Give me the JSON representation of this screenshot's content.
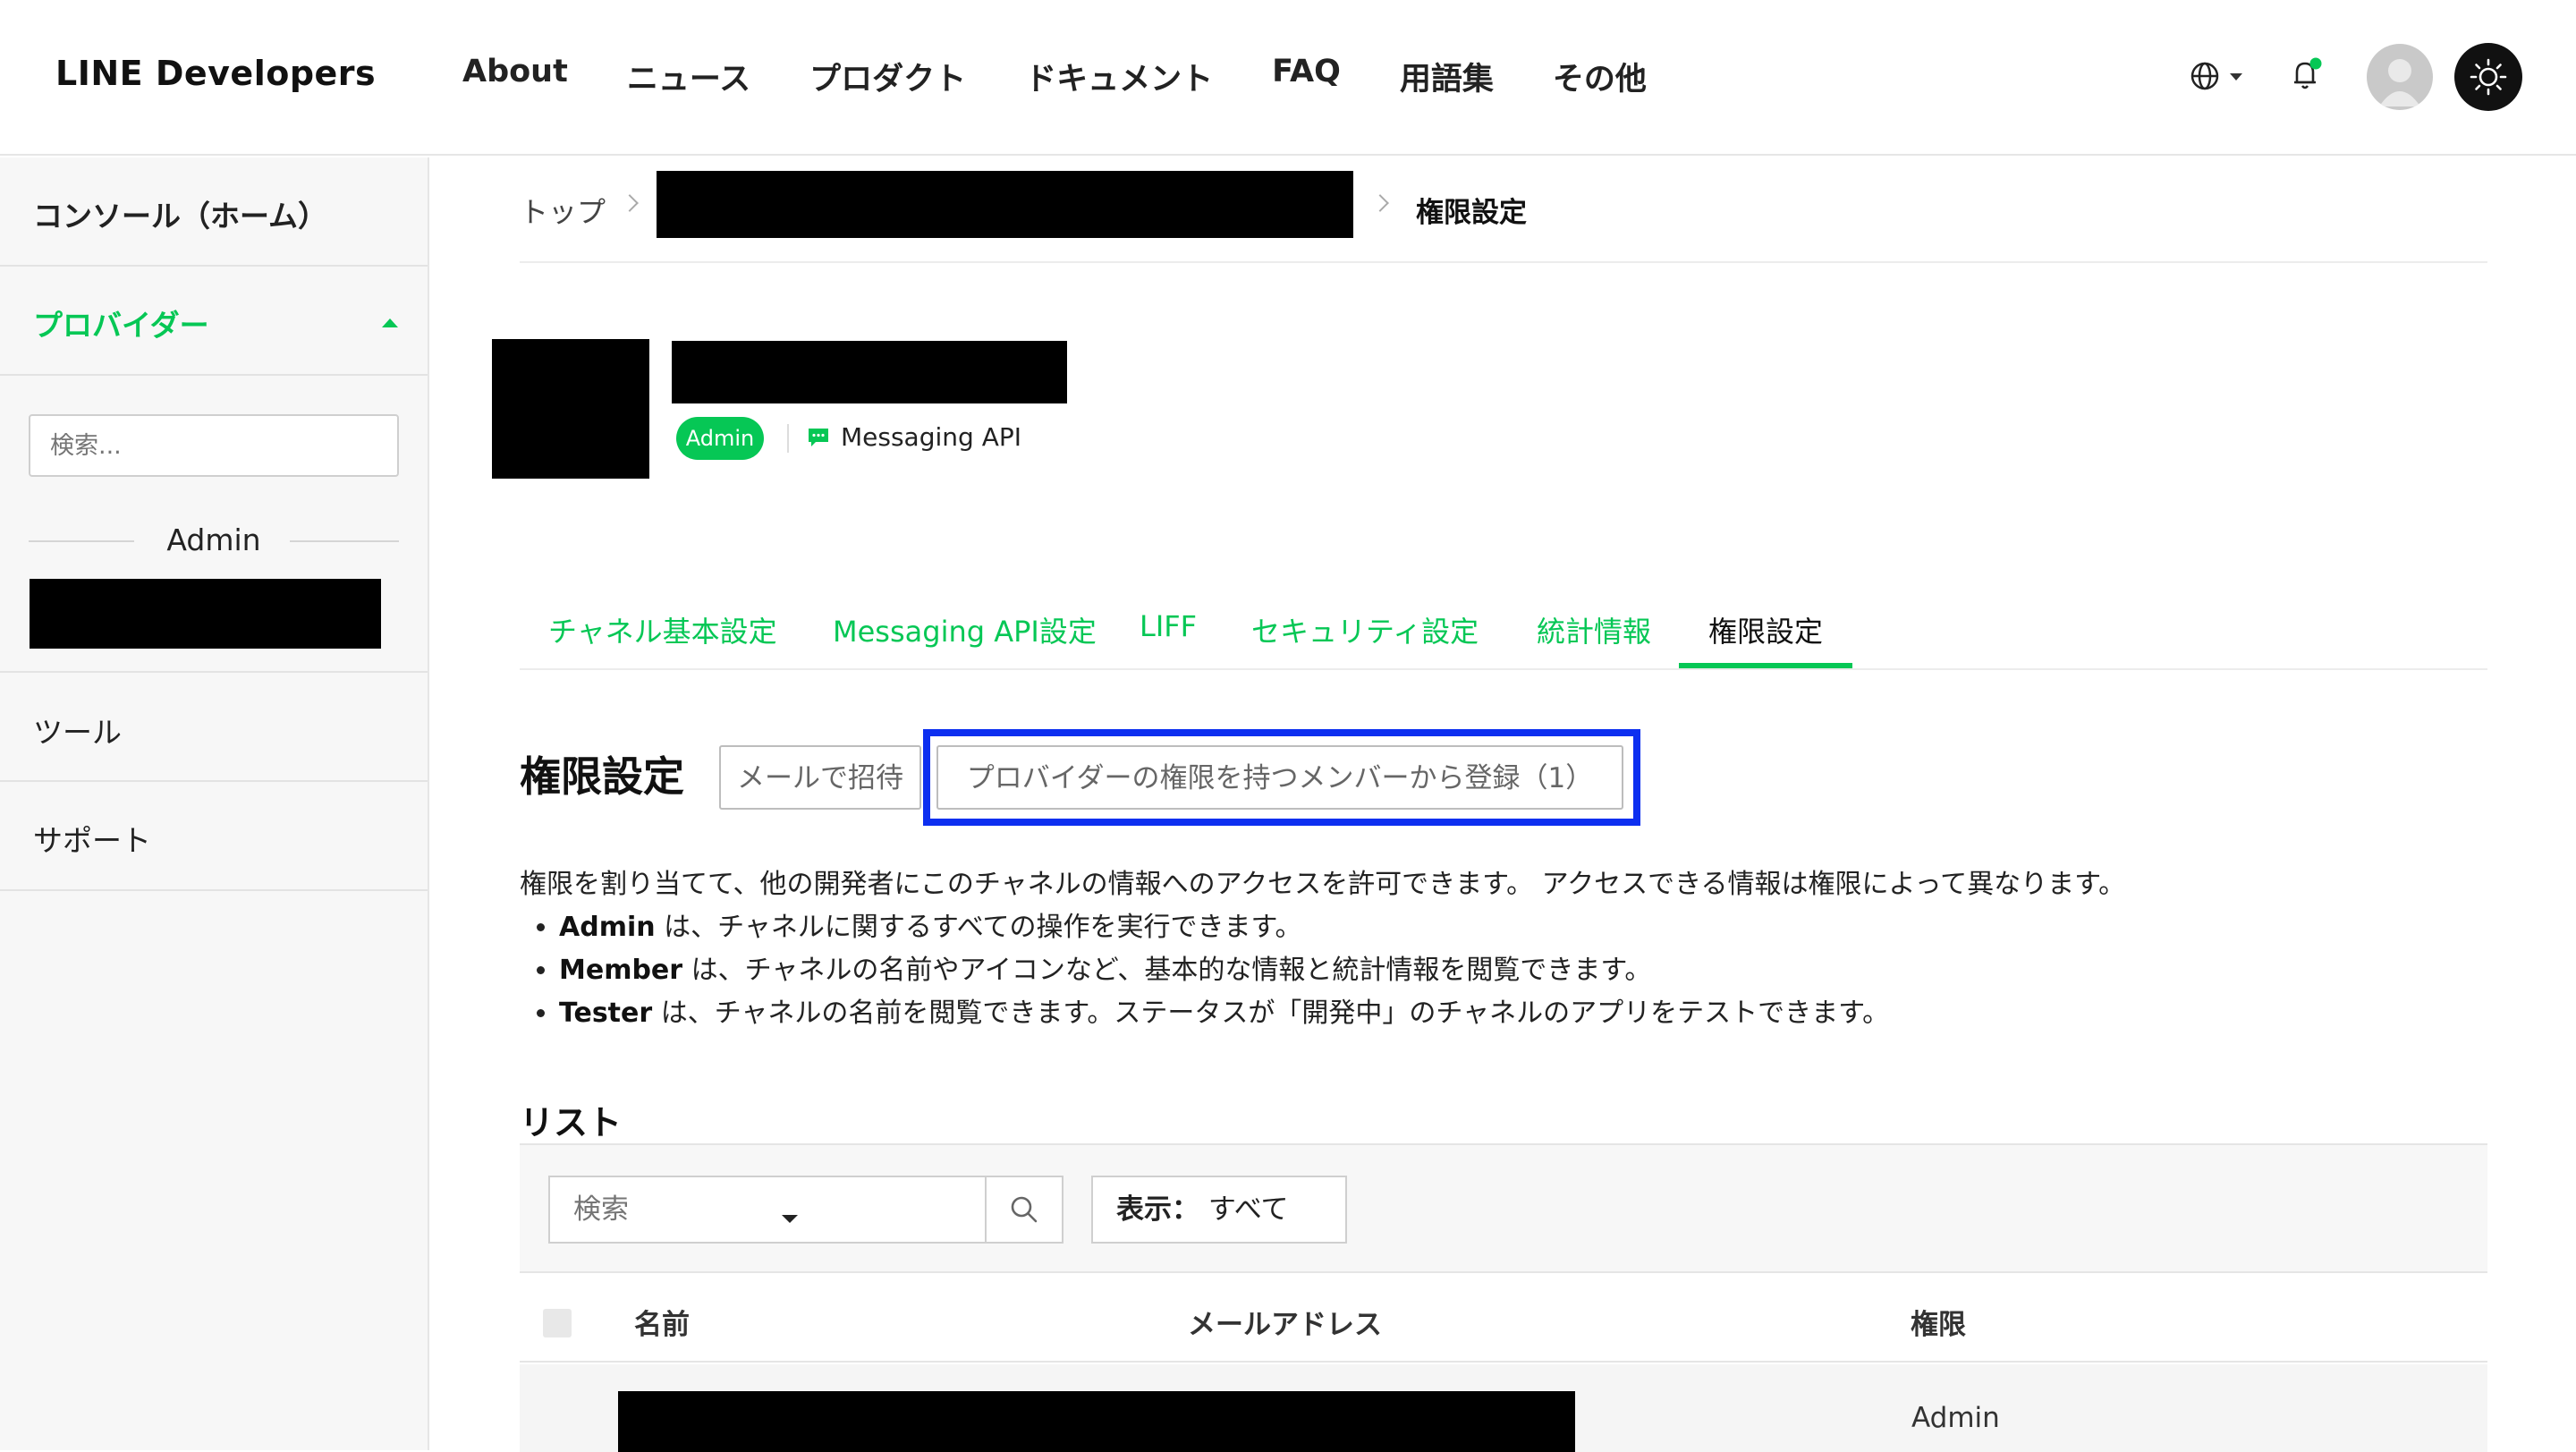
{
  "header": {
    "logo": "LINE Developers",
    "nav": [
      "About",
      "ニュース",
      "プロダクト",
      "ドキュメント",
      "FAQ",
      "用語集",
      "その他"
    ],
    "icons": [
      "globe-icon",
      "bell-icon",
      "avatar",
      "sun-icon"
    ],
    "notification_dot_color": "#06c755"
  },
  "sidebar": {
    "console": "コンソール（ホーム）",
    "provider": "プロバイダー",
    "search_placeholder": "検索...",
    "role_heading": "Admin",
    "tools": "ツール",
    "support": "サポート"
  },
  "breadcrumb": {
    "top": "トップ",
    "current": "権限設定"
  },
  "channel": {
    "role_badge": "Admin",
    "type": "Messaging API"
  },
  "tabs": [
    "チャネル基本設定",
    "Messaging API設定",
    "LIFF",
    "セキュリティ設定",
    "統計情報",
    "権限設定"
  ],
  "permissions": {
    "title": "権限設定",
    "invite_button": "メールで招待",
    "register_button": "プロバイダーの権限を持つメンバーから登録（1）",
    "description": "権限を割り当てて、他の開発者にこのチャネルの情報へのアクセスを許可できます。 アクセスできる情報は権限によって異なります。",
    "roles": [
      {
        "name": "Admin",
        "text": " は、チャネルに関するすべての操作を実行できます。"
      },
      {
        "name": "Member",
        "text": " は、チャネルの名前やアイコンなど、基本的な情報と統計情報を閲覧できます。"
      },
      {
        "name": "Tester",
        "text": " は、チャネルの名前を閲覧できます。ステータスが「開発中」のチャネルのアプリをテストできます。"
      }
    ]
  },
  "list": {
    "title": "リスト",
    "search_placeholder": "検索",
    "filter_label": "表示：",
    "filter_value": "すべて",
    "columns": [
      "名前",
      "メールアドレス",
      "権限"
    ],
    "rows": [
      {
        "role": "Admin"
      }
    ]
  },
  "colors": {
    "accent": "#06c755",
    "highlight": "#0d2ff0"
  }
}
